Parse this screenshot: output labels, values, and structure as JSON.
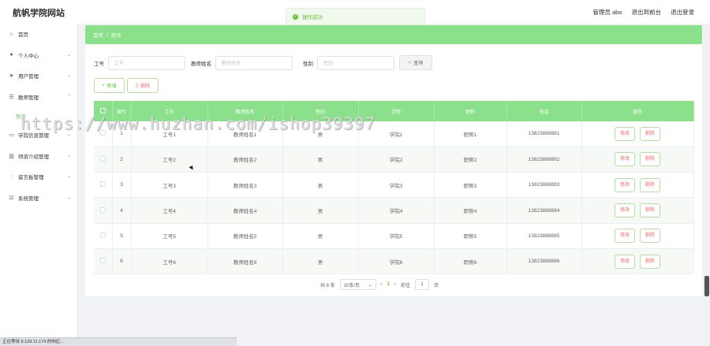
{
  "header": {
    "title": "航帆学院网站",
    "admin_label": "管理员 abo",
    "back_label": "退出到前台",
    "logout_label": "退出登录"
  },
  "toast": {
    "message": "操作成功"
  },
  "sidebar": {
    "items": [
      {
        "label": "首页",
        "icon": "home-icon",
        "glyph": "⌂"
      },
      {
        "label": "个人中心",
        "icon": "user-icon",
        "glyph": "👤"
      },
      {
        "label": "用户管理",
        "icon": "send-icon",
        "glyph": "➤"
      },
      {
        "label": "教师管理",
        "icon": "sliders-icon",
        "glyph": "☰"
      },
      {
        "label": "学院信息管理",
        "icon": "document-icon",
        "glyph": "▭"
      },
      {
        "label": "师资介绍管理",
        "icon": "chart-icon",
        "glyph": "▥"
      },
      {
        "label": "留言板管理",
        "icon": "chat-icon",
        "glyph": "◌"
      },
      {
        "label": "系统管理",
        "icon": "check-box-icon",
        "glyph": "☑"
      }
    ],
    "sub_item": "教师"
  },
  "breadcrumb": {
    "home": "首页",
    "separator": "/",
    "current": "教师"
  },
  "search": {
    "field1_label": "工号",
    "field1_placeholder": "工号",
    "field2_label": "教师姓名",
    "field2_placeholder": "教师姓名",
    "field3_label": "性别",
    "field3_placeholder": "性别",
    "search_button": "查询"
  },
  "actions": {
    "add": "新增",
    "delete": "删除"
  },
  "table": {
    "headers": [
      "索引",
      "工号",
      "教师姓名",
      "性别",
      "学院",
      "职称",
      "电话",
      "操作"
    ],
    "rows": [
      {
        "index": "1",
        "id": "工号1",
        "name": "教师姓名1",
        "gender": "男",
        "college": "学院1",
        "title": "职称1",
        "phone": "13823888881"
      },
      {
        "index": "2",
        "id": "工号2",
        "name": "教师姓名2",
        "gender": "男",
        "college": "学院2",
        "title": "职称2",
        "phone": "13823888882"
      },
      {
        "index": "3",
        "id": "工号3",
        "name": "教师姓名3",
        "gender": "男",
        "college": "学院3",
        "title": "职称3",
        "phone": "13823888883"
      },
      {
        "index": "4",
        "id": "工号4",
        "name": "教师姓名4",
        "gender": "男",
        "college": "学院4",
        "title": "职称4",
        "phone": "13823888884"
      },
      {
        "index": "5",
        "id": "工号5",
        "name": "教师姓名5",
        "gender": "男",
        "college": "学院5",
        "title": "职称5",
        "phone": "13823888885"
      },
      {
        "index": "6",
        "id": "工号6",
        "name": "教师姓名6",
        "gender": "男",
        "college": "学院6",
        "title": "职称6",
        "phone": "13823888886"
      }
    ],
    "edit_label": "修改",
    "delete_label": "删除"
  },
  "pagination": {
    "total": "共 6 条",
    "page_size": "10条/页",
    "prev": "‹",
    "current": "1",
    "next": "›",
    "goto_label": "前往",
    "goto_value": "1",
    "page_suffix": "页"
  },
  "watermark": "https://www.huzhan.com/ishop39397",
  "statusbar": "正在等待 8.129.11.174 的响应..."
}
